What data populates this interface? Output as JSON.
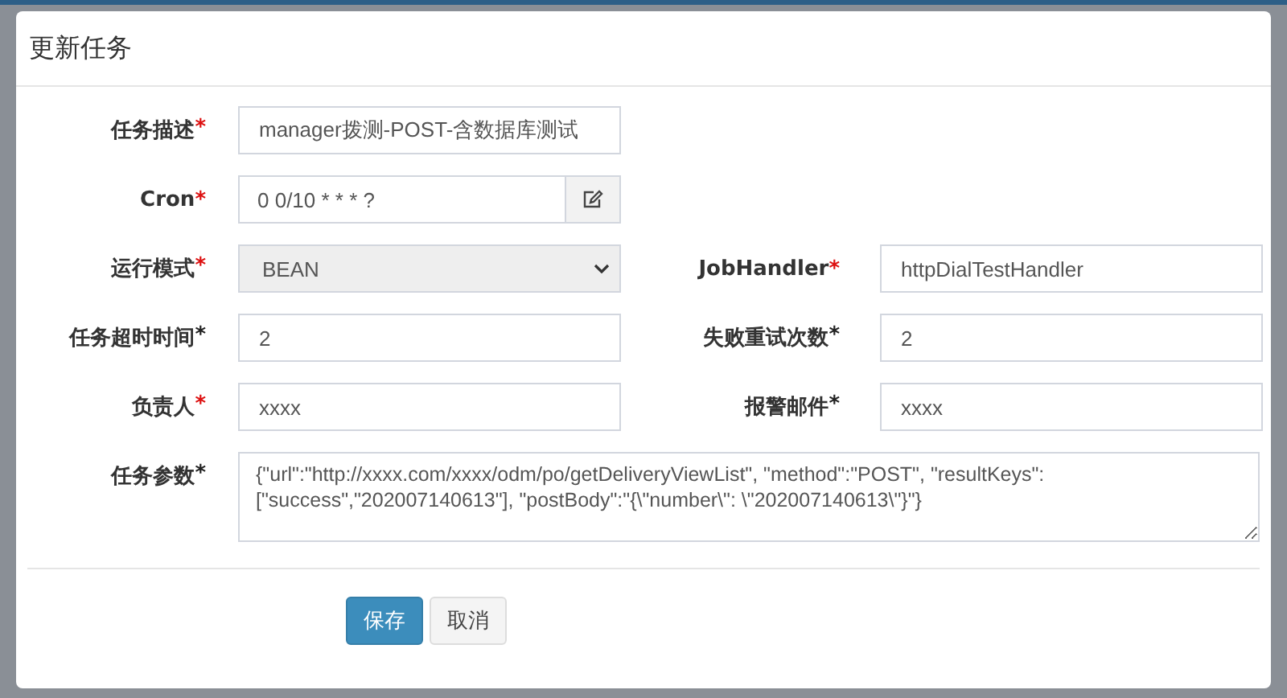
{
  "dialog": {
    "title": "更新任务"
  },
  "rows": [
    {
      "fields": [
        {
          "label": "任务描述",
          "star": "*",
          "star_red": true,
          "kind": "text",
          "value": "manager拨测-POST-含数据库测试"
        }
      ]
    },
    {
      "fields": [
        {
          "label": "Cron",
          "star": "*",
          "star_red": true,
          "kind": "cron",
          "value": "0 0/10 * * * ?"
        }
      ]
    },
    {
      "fields": [
        {
          "label": "运行模式",
          "star": "*",
          "star_red": true,
          "kind": "select",
          "value": "BEAN"
        },
        {
          "label": "JobHandler",
          "star": "*",
          "star_red": true,
          "kind": "text",
          "value": "httpDialTestHandler"
        }
      ]
    },
    {
      "fields": [
        {
          "label": "任务超时时间",
          "star": "*",
          "star_red": false,
          "kind": "text",
          "value": "2"
        },
        {
          "label": "失败重试次数",
          "star": "*",
          "star_red": false,
          "kind": "text",
          "value": "2"
        }
      ]
    },
    {
      "fields": [
        {
          "label": "负责人",
          "star": "*",
          "star_red": true,
          "kind": "text",
          "value": "xxxx"
        },
        {
          "label": "报警邮件",
          "star": "*",
          "star_red": false,
          "kind": "text",
          "value": "xxxx"
        }
      ]
    },
    {
      "fields": [
        {
          "label": "任务参数",
          "star": "*",
          "star_red": false,
          "kind": "textarea",
          "value": "{\"url\":\"http://xxxx.com/xxxx/odm/po/getDeliveryViewList\", \"method\":\"POST\", \"resultKeys\": [\"success\",\"202007140613\"], \"postBody\":\"{\\\"number\\\": \\\"202007140613\\\"}\"}"
        }
      ]
    }
  ],
  "buttons": [
    {
      "label": "保存",
      "kind": "primary"
    },
    {
      "label": "取消",
      "kind": "default"
    }
  ]
}
